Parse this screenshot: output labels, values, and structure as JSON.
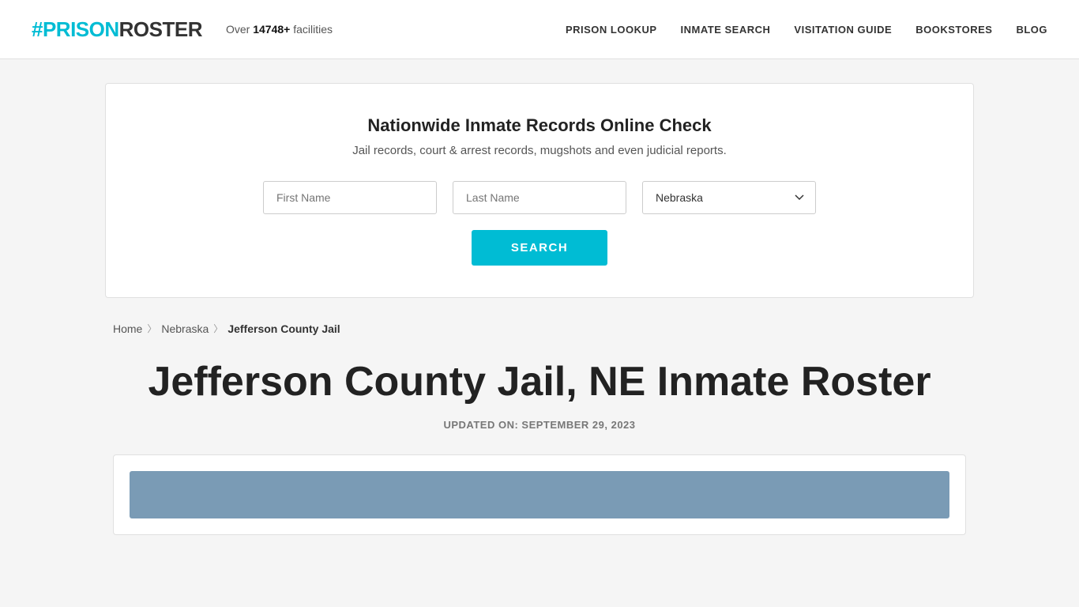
{
  "header": {
    "logo": {
      "hash": "#",
      "prison": "PRISON",
      "roster": "ROSTER"
    },
    "facilities_prefix": "Over ",
    "facilities_count": "14748+",
    "facilities_suffix": " facilities",
    "nav": [
      {
        "label": "PRISON LOOKUP",
        "href": "#"
      },
      {
        "label": "INMATE SEARCH",
        "href": "#"
      },
      {
        "label": "VISITATION GUIDE",
        "href": "#"
      },
      {
        "label": "BOOKSTORES",
        "href": "#"
      },
      {
        "label": "BLOG",
        "href": "#"
      }
    ]
  },
  "search_section": {
    "title": "Nationwide Inmate Records Online Check",
    "subtitle": "Jail records, court & arrest records, mugshots and even judicial reports.",
    "first_name_placeholder": "First Name",
    "last_name_placeholder": "Last Name",
    "state_default": "Nebraska",
    "search_button_label": "SEARCH"
  },
  "breadcrumb": {
    "home": "Home",
    "state": "Nebraska",
    "current": "Jefferson County Jail"
  },
  "main": {
    "page_title": "Jefferson County Jail, NE Inmate Roster",
    "updated_label": "UPDATED ON: SEPTEMBER 29, 2023"
  }
}
